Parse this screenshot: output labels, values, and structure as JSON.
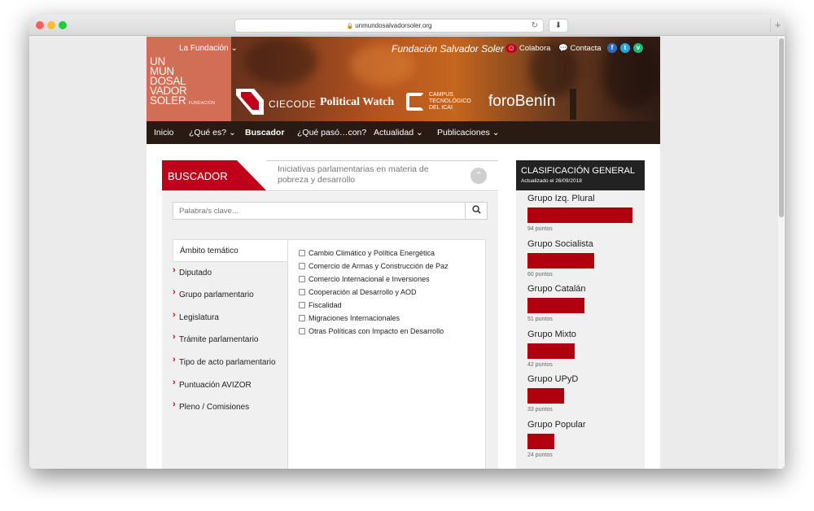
{
  "browser": {
    "url": "unmundosalvadorsoler.org"
  },
  "header": {
    "logo_lines": [
      "UN",
      "MUN",
      "DOSAL",
      "VADOR",
      "SOLER"
    ],
    "logo_sub": "FUNDACIÓN",
    "top_left": "La Fundación ⌄",
    "foundation": "Fundación Salvador Soler",
    "colabora": "Colabora",
    "contacta": "Contacta",
    "social": [
      {
        "icon": "facebook-icon",
        "glyph": "f",
        "color": "#2d6dc8"
      },
      {
        "icon": "twitter-icon",
        "glyph": "t",
        "color": "#29a3e6"
      },
      {
        "icon": "vine-icon",
        "glyph": "v",
        "color": "#1dbb79"
      }
    ],
    "partners": {
      "ciecode": "CIECODE",
      "political_watch": "Political Watch",
      "icai": [
        "CAMPUS",
        "TECNOLÓGICO",
        "DEL ICAI"
      ],
      "foro": "foroBenín"
    }
  },
  "nav": {
    "items": [
      "Inicio",
      "¿Qué es? ⌄",
      "Buscador",
      "¿Qué pasó…con?",
      "Actualidad ⌄",
      "Publicaciones ⌄"
    ]
  },
  "buscador": {
    "label": "BUSCADOR",
    "description": "Iniciativas parlamentarias en materia de pobreza y desarrollo",
    "placeholder": "Palabra/s clave...",
    "tabs": [
      "Ámbito temático",
      "Diputado",
      "Grupo parlamentario",
      "Legislatura",
      "Trámite parlamentario",
      "Tipo de acto parlamentario",
      "Puntuación AVIZOR",
      "Pleno / Comisiones"
    ],
    "options": [
      "Cambio Climático y Política Energética",
      "Comercio de Armas y Construcción de Paz",
      "Comercio Internacional e Inversiones",
      "Cooperación al Desarrollo y AOD",
      "Fiscalidad",
      "Migraciones Internacionales",
      "Otras Políticas con Impacto en Desarrollo"
    ]
  },
  "ranking": {
    "title": "CLASIFICACIÓN GENERAL",
    "updated": "Actualizado el 26/09/2018",
    "bar_color": "#b0000f",
    "max_points": 94,
    "groups": [
      {
        "name": "Grupo Izq. Plural",
        "points": 94,
        "label": "94 puntos"
      },
      {
        "name": "Grupo Socialista",
        "points": 60,
        "label": "60 puntos"
      },
      {
        "name": "Grupo Catalán",
        "points": 51,
        "label": "51 puntos"
      },
      {
        "name": "Grupo Mixto",
        "points": 42,
        "label": "42 puntos"
      },
      {
        "name": "Grupo UPyD",
        "points": 33,
        "label": "33 puntos"
      },
      {
        "name": "Grupo Popular",
        "points": 24,
        "label": "24 puntos"
      }
    ]
  }
}
